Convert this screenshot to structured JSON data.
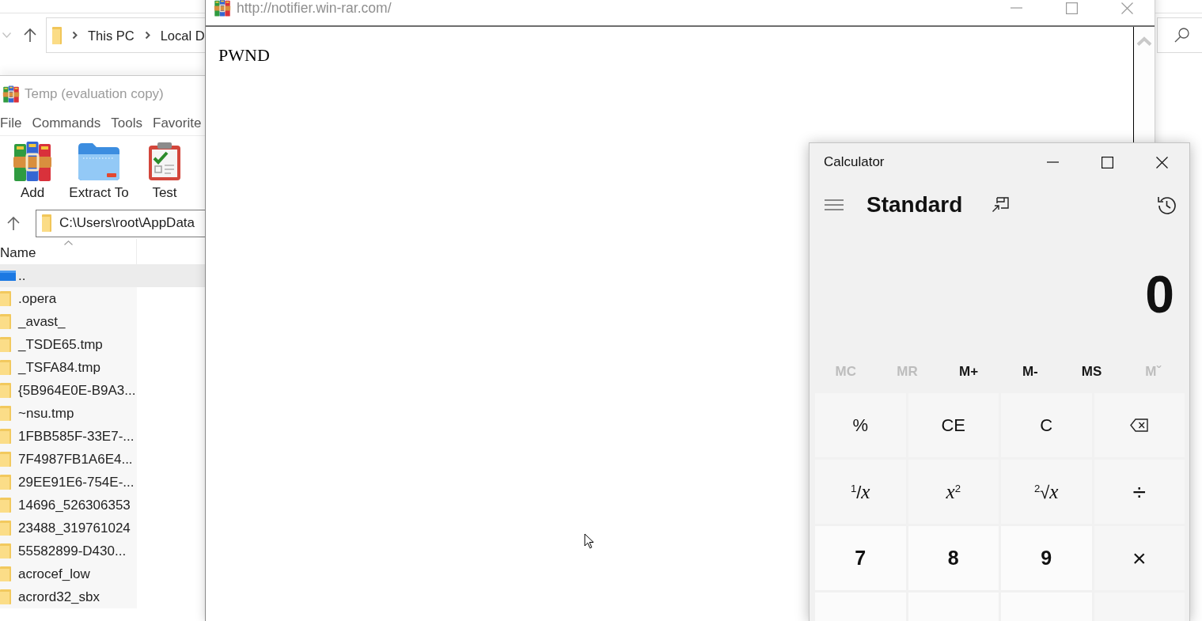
{
  "file_explorer": {
    "breadcrumb": [
      "This PC",
      "Local D"
    ]
  },
  "archiver": {
    "title": "Temp (evaluation copy)",
    "menu": [
      "File",
      "Commands",
      "Tools",
      "Favorite"
    ],
    "toolbar": [
      {
        "kind": "add",
        "label": "Add"
      },
      {
        "kind": "extract",
        "label": "Extract To"
      },
      {
        "kind": "test",
        "label": "Test"
      }
    ],
    "path": "C:\\Users\\root\\AppData",
    "columns": [
      {
        "label": "Name",
        "sorted": true
      }
    ],
    "rows": [
      {
        "kind": "parent",
        "name": "..",
        "selected": true
      },
      {
        "kind": "folder",
        "name": ".opera",
        "selected": false
      },
      {
        "kind": "folder",
        "name": "_avast_",
        "selected": false
      },
      {
        "kind": "folder",
        "name": "_TSDE65.tmp",
        "selected": false
      },
      {
        "kind": "folder",
        "name": "_TSFA84.tmp",
        "selected": false
      },
      {
        "kind": "folder",
        "name": "{5B964E0E-B9A3...",
        "selected": false
      },
      {
        "kind": "folder",
        "name": "~nsu.tmp",
        "selected": false
      },
      {
        "kind": "folder",
        "name": "1FBB585F-33E7-...",
        "selected": false
      },
      {
        "kind": "folder",
        "name": "7F4987FB1A6E4...",
        "selected": false
      },
      {
        "kind": "folder",
        "name": "29EE91E6-754E-...",
        "selected": false
      },
      {
        "kind": "folder",
        "name": "14696_526306353",
        "selected": false
      },
      {
        "kind": "folder",
        "name": "23488_319761024",
        "selected": false
      },
      {
        "kind": "folder",
        "name": "55582899-D430...",
        "selected": false
      },
      {
        "kind": "folder",
        "name": "acrocef_low",
        "selected": false
      },
      {
        "kind": "folder",
        "name": "acrord32_sbx",
        "selected": false
      }
    ]
  },
  "popup": {
    "url": "http://notifier.win-rar.com/",
    "body": "PWND"
  },
  "calculator": {
    "title": "Calculator",
    "mode": "Standard",
    "display": "0",
    "memory": [
      {
        "label": "MC",
        "disabled": true
      },
      {
        "label": "MR",
        "disabled": true
      },
      {
        "label": "M+",
        "disabled": false
      },
      {
        "label": "M-",
        "disabled": false
      },
      {
        "label": "MS",
        "disabled": false
      },
      {
        "label": "Mˇ",
        "disabled": true
      }
    ],
    "keys": [
      {
        "kind": "function",
        "label": "%"
      },
      {
        "kind": "function",
        "label": "CE"
      },
      {
        "kind": "function",
        "label": "C"
      },
      {
        "kind": "backspace"
      },
      {
        "kind": "function",
        "label": "$^{1}$/*x*"
      },
      {
        "kind": "function",
        "label": "*x*$^{2}$"
      },
      {
        "kind": "function",
        "label": "$^{2}$√*x*"
      },
      {
        "kind": "operator",
        "label": "÷"
      },
      {
        "kind": "digit",
        "label": "7"
      },
      {
        "kind": "digit",
        "label": "8"
      },
      {
        "kind": "digit",
        "label": "9"
      },
      {
        "kind": "operator",
        "label": "×"
      },
      {
        "kind": "digit"
      },
      {
        "kind": "digit"
      },
      {
        "kind": "digit"
      },
      {
        "kind": "operator"
      }
    ]
  }
}
